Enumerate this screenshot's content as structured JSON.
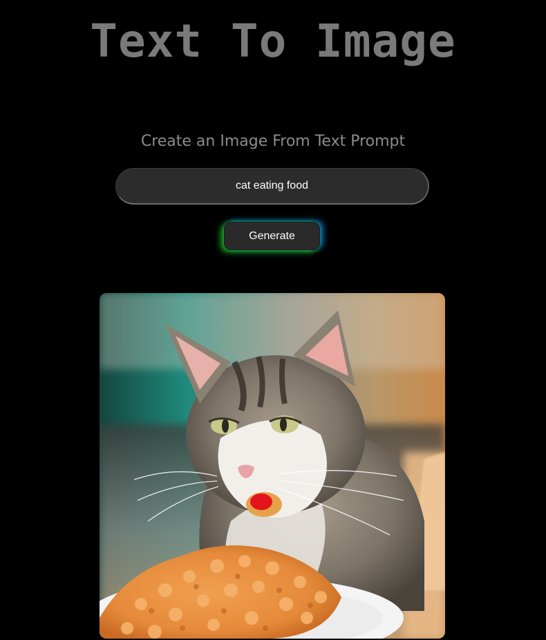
{
  "header": {
    "title": "Text To Image"
  },
  "form": {
    "subtitle": "Create an Image From Text Prompt",
    "prompt_value": "cat eating food",
    "generate_label": "Generate"
  },
  "result": {
    "image_subject": "cat eating food",
    "colors": {
      "background_teal": "#1f8a7c",
      "background_warm": "#c98a4a",
      "fur_grey": "#7d7468",
      "fur_white": "#f2efeb",
      "food_orange": "#e58a3a",
      "plate_white": "#f4f4f4"
    }
  },
  "colors": {
    "page_background": "#000000",
    "title": "#7a7a7a",
    "subtitle": "#8c8c8c",
    "input_background": "#2c2c2c",
    "button_glow_green": "#20c828",
    "button_glow_blue": "#148cdc"
  }
}
